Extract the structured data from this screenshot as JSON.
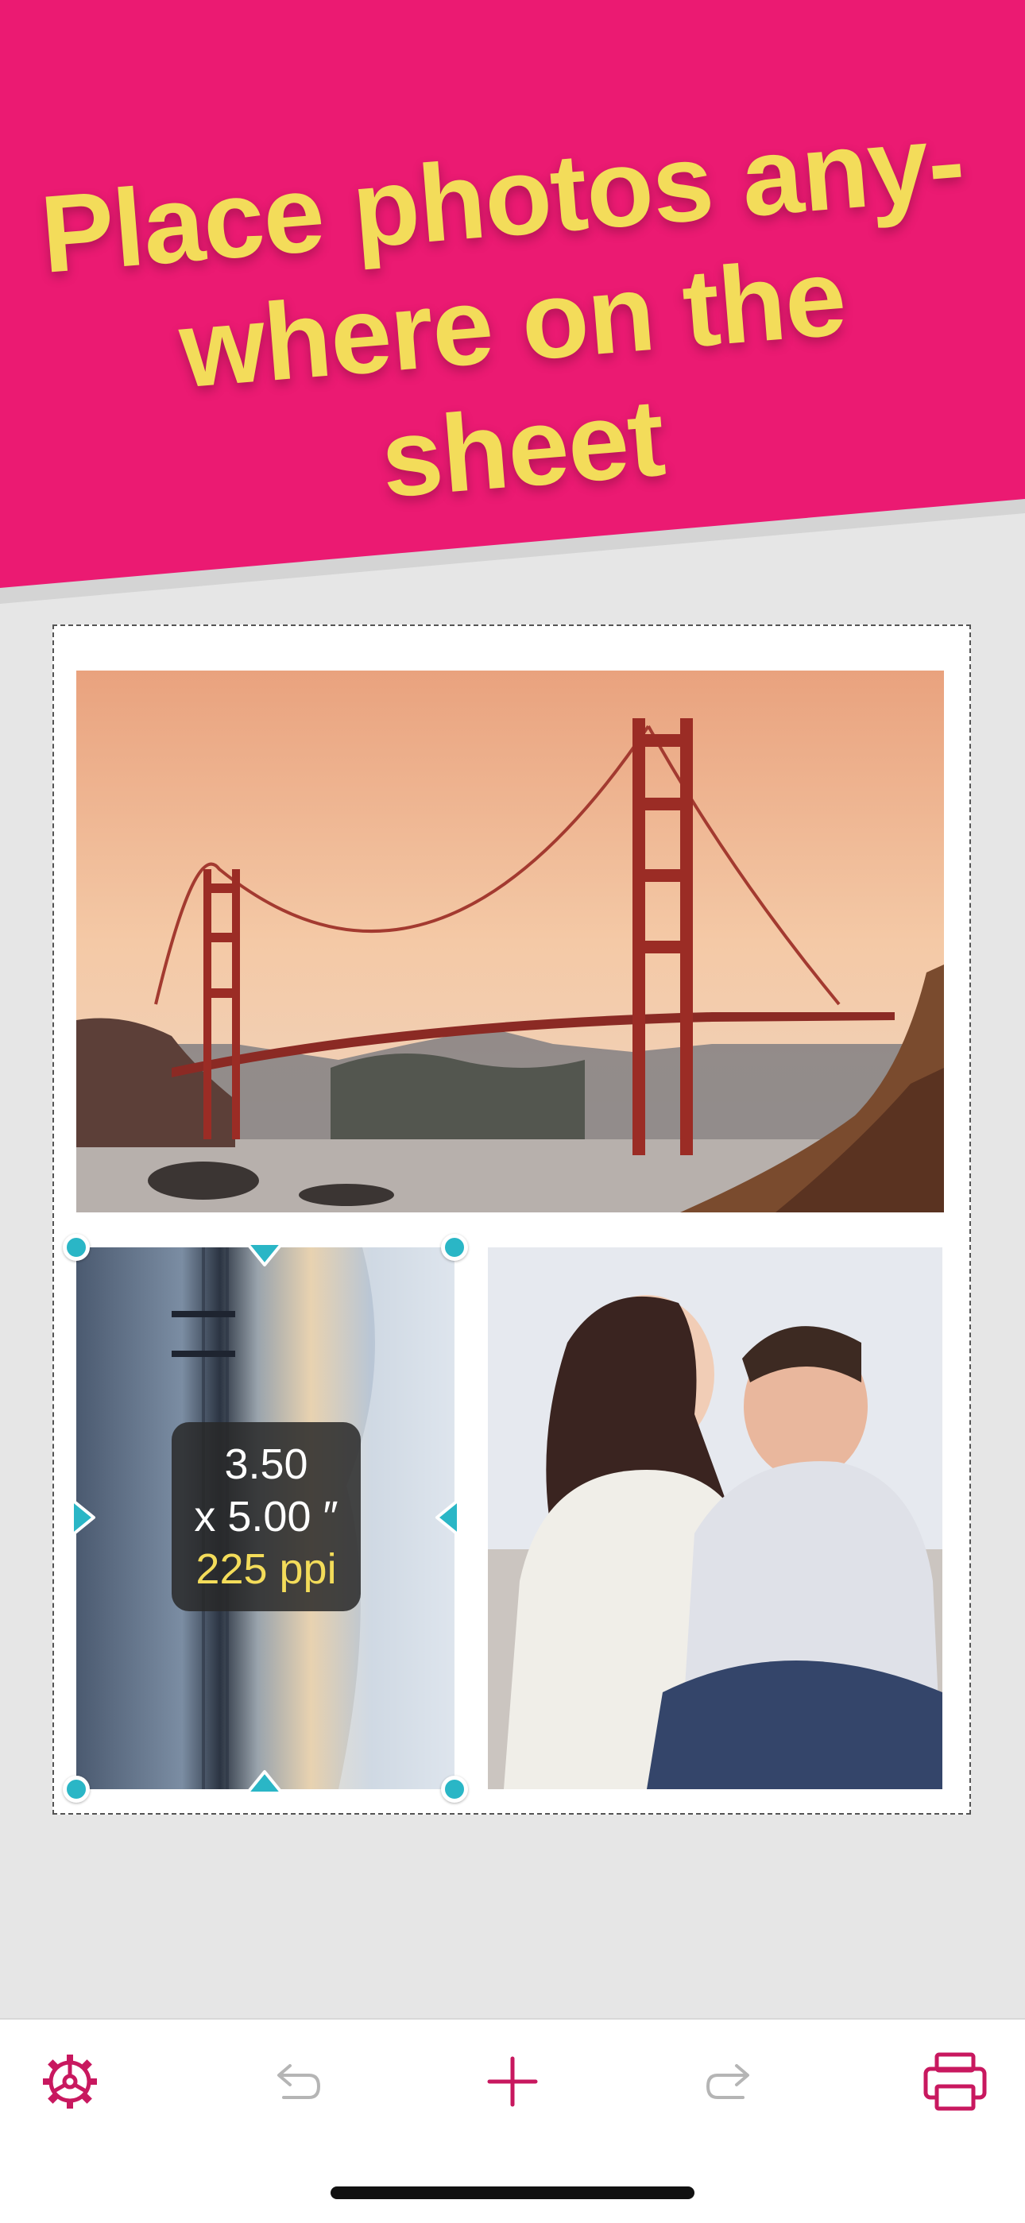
{
  "banner": {
    "headline_line1": "Place photos any-",
    "headline_line2": "where on the sheet"
  },
  "sheet": {
    "photos": [
      {
        "name": "golden-gate-bridge-photo"
      },
      {
        "name": "beach-sunset-photo",
        "selected": true
      },
      {
        "name": "laughing-couple-photo"
      }
    ],
    "size_tooltip": {
      "width": "3.50",
      "height": "x 5.00 ″",
      "resolution": "225 ppi"
    }
  },
  "toolbar": {
    "items": [
      {
        "icon": "gear-icon",
        "enabled": true
      },
      {
        "icon": "undo-icon",
        "enabled": false
      },
      {
        "icon": "plus-icon",
        "enabled": true
      },
      {
        "icon": "redo-icon",
        "enabled": false
      },
      {
        "icon": "printer-icon",
        "enabled": true
      }
    ]
  },
  "colors": {
    "accent": "#eb1a72",
    "headline": "#f3dc5a",
    "handle": "#2ab6c6"
  }
}
